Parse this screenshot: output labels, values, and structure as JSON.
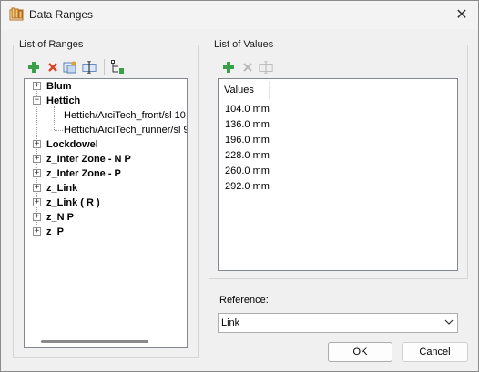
{
  "window": {
    "title": "Data Ranges",
    "close_glyph": "✕"
  },
  "ranges": {
    "group_label": "List of Ranges",
    "toolbar": {
      "add_icon": "plus-icon",
      "delete_icon": "delete-icon",
      "copy_icon": "copy-icon",
      "rename_icon": "rename-icon",
      "tree_icon": "tree-add-icon"
    },
    "items": [
      {
        "label": "Blum",
        "expander": "+",
        "level": 0
      },
      {
        "label": "Hettich",
        "expander": "−",
        "level": 0
      },
      {
        "label": "Hettich/ArciTech_front/sl 10",
        "expander": "",
        "level": 1
      },
      {
        "label": "Hettich/ArciTech_runner/sl 9",
        "expander": "",
        "level": 1
      },
      {
        "label": "Lockdowel",
        "expander": "+",
        "level": 0
      },
      {
        "label": "z_Inter Zone - N P",
        "expander": "+",
        "level": 0
      },
      {
        "label": "z_Inter Zone - P",
        "expander": "+",
        "level": 0
      },
      {
        "label": "z_Link",
        "expander": "+",
        "level": 0
      },
      {
        "label": "z_Link ( R )",
        "expander": "+",
        "level": 0
      },
      {
        "label": "z_N P",
        "expander": "+",
        "level": 0
      },
      {
        "label": "z_P",
        "expander": "+",
        "level": 0
      }
    ]
  },
  "values": {
    "group_label": "List of Values",
    "column_header": "Values",
    "rows": [
      "104.0 mm",
      "136.0 mm",
      "196.0 mm",
      "228.0 mm",
      "260.0 mm",
      "292.0 mm"
    ]
  },
  "reference": {
    "label": "Reference:",
    "selected": "Link"
  },
  "buttons": {
    "ok": "OK",
    "cancel": "Cancel"
  },
  "colors": {
    "add_green": "#3aa14a",
    "delete_red": "#d9442a",
    "disabled_gray": "#b8b8b8"
  }
}
